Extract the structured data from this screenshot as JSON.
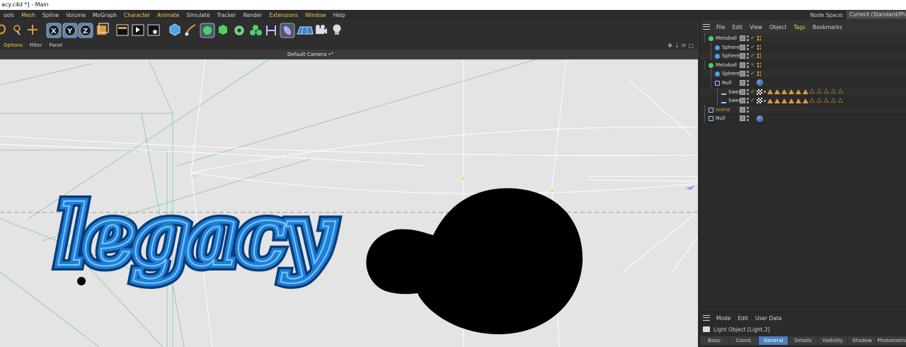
{
  "window": {
    "title": "acy.c4d *] - Main"
  },
  "menubar": {
    "items": [
      {
        "label": "ools",
        "highlight": false
      },
      {
        "label": "Mesh",
        "highlight": true
      },
      {
        "label": "Spline",
        "highlight": false
      },
      {
        "label": "Volume",
        "highlight": false
      },
      {
        "label": "MoGraph",
        "highlight": false
      },
      {
        "label": "Character",
        "highlight": true
      },
      {
        "label": "Animate",
        "highlight": true
      },
      {
        "label": "Simulate",
        "highlight": false
      },
      {
        "label": "Tracker",
        "highlight": false
      },
      {
        "label": "Render",
        "highlight": false
      },
      {
        "label": "Extensions",
        "highlight": true
      },
      {
        "label": "Window",
        "highlight": true
      },
      {
        "label": "Help",
        "highlight": false
      }
    ],
    "node_space_label": "Node Space:",
    "node_space_value": "Current (Standard/Physical)"
  },
  "toolbar": {
    "icons": [
      "undo-icon",
      "live-select-icon",
      "move-icon",
      "lock-x-icon",
      "lock-y-icon",
      "lock-z-icon",
      "coordinate-system-icon",
      "render-view-icon",
      "render-picture-viewer-icon",
      "render-settings-icon",
      "cube-icon",
      "pen-icon",
      "subdivision-icon",
      "extrude-icon",
      "cloner-icon",
      "metaball-icon",
      "deformer-icon",
      "spline-icon",
      "floor-icon",
      "camera-icon",
      "light-icon"
    ]
  },
  "viewport": {
    "menu": [
      {
        "label": "Options",
        "highlight": true
      },
      {
        "label": "Filter",
        "highlight": false
      },
      {
        "label": "Panel",
        "highlight": false
      }
    ],
    "camera_label": "Default Camera •°",
    "nav_icons": [
      "pan-icon",
      "dolly-icon",
      "rotate-icon",
      "maximize-icon"
    ],
    "text_object": "legacy"
  },
  "object_manager": {
    "menu": [
      {
        "label": "File",
        "highlight": false
      },
      {
        "label": "Edit",
        "highlight": false
      },
      {
        "label": "View",
        "highlight": false
      },
      {
        "label": "Object",
        "highlight": false
      },
      {
        "label": "Tags",
        "highlight": true
      },
      {
        "label": "Bookmarks",
        "highlight": false
      }
    ],
    "rows": [
      {
        "name": "Metaball",
        "indent": 0,
        "type": "metaball",
        "enabled": true
      },
      {
        "name": "Sphere",
        "indent": 1,
        "type": "sphere",
        "enabled": true
      },
      {
        "name": "Sphere",
        "indent": 1,
        "type": "sphere",
        "enabled": true
      },
      {
        "name": "Metaball",
        "indent": 0,
        "type": "metaball",
        "enabled": false
      },
      {
        "name": "Sphere",
        "indent": 1,
        "type": "sphere",
        "enabled": true
      },
      {
        "name": "Null",
        "indent": 1,
        "type": "null",
        "enabled": null
      },
      {
        "name": "Swee",
        "indent": 2,
        "type": "sweep",
        "enabled": true
      },
      {
        "name": "Swee",
        "indent": 2,
        "type": "sweep",
        "enabled": true
      },
      {
        "name": "scene",
        "indent": 0,
        "type": "null-orange",
        "enabled": null
      },
      {
        "name": "Null",
        "indent": 0,
        "type": "null",
        "enabled": null
      }
    ]
  },
  "attribute_manager": {
    "menu": [
      {
        "label": "Mode"
      },
      {
        "label": "Edit"
      },
      {
        "label": "User Data"
      }
    ],
    "object_title": "Light Object [Light.2]",
    "tabs": [
      {
        "label": "Basic",
        "active": false
      },
      {
        "label": "Coord.",
        "active": false
      },
      {
        "label": "General",
        "active": true
      },
      {
        "label": "Details",
        "active": false
      },
      {
        "label": "Visibility",
        "active": false
      },
      {
        "label": "Shadow",
        "active": false
      },
      {
        "label": "Photometric",
        "active": false
      }
    ]
  },
  "colors": {
    "accent": "#f2c94c",
    "tab_active": "#4e7fc1",
    "viewport_bg": "#e4e4e4",
    "text_object_blue": "#1e7fd6"
  }
}
